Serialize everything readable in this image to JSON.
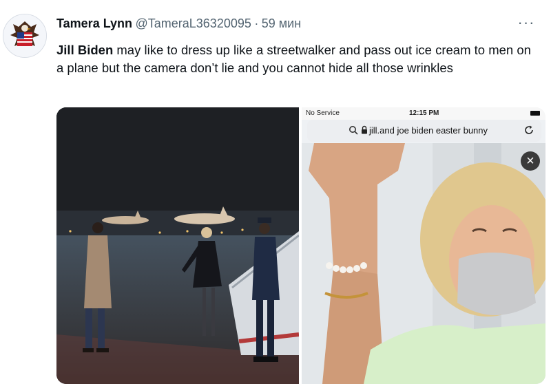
{
  "author": {
    "name": "Tamera Lynn",
    "handle": "@TameraL36320095",
    "separator": "·",
    "time": "59 мин"
  },
  "tweet": {
    "bold_text": "Jill Biden",
    "body": " may like to dress up like a streetwalker and pass out ice cream to men on a plane but the camera don’t lie and you cannot hide all those wrinkles"
  },
  "more_label": "···",
  "phone": {
    "status_service": "No Service",
    "status_time": "12:15 PM",
    "url": "jill.and joe biden easter bunny",
    "close_label": "×"
  },
  "icons": [
    "avatar-eagle-flag",
    "more-icon",
    "search-icon",
    "lock-icon",
    "reload-icon",
    "close-icon",
    "battery-icon",
    "wifi-icon"
  ],
  "colors": {
    "text_primary": "#0f1419",
    "text_secondary": "#536471"
  }
}
